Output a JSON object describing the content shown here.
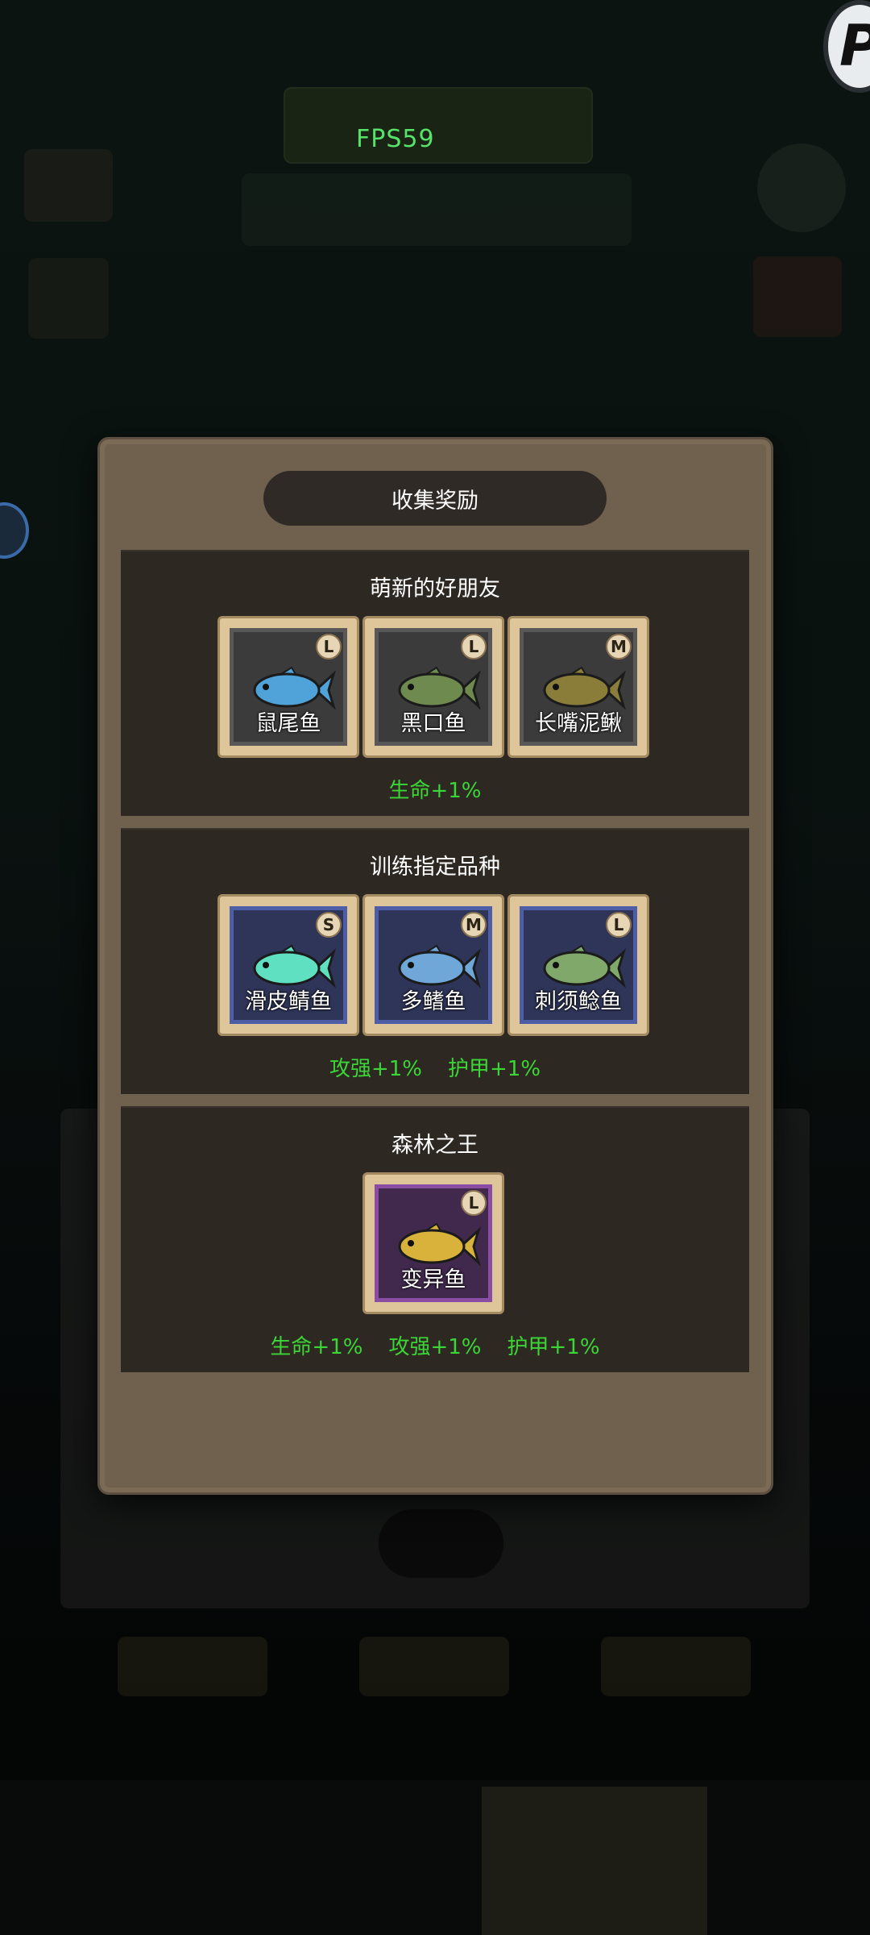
{
  "overlay": {
    "fps": "FPS59"
  },
  "modal": {
    "title": "收集奖励",
    "sections": [
      {
        "title": "萌新的好朋友",
        "fish": [
          {
            "name": "鼠尾鱼",
            "rank": "L",
            "frame": "gray",
            "color": "#4fa3d8"
          },
          {
            "name": "黑口鱼",
            "rank": "L",
            "frame": "gray",
            "color": "#6f8a4e"
          },
          {
            "name": "长嘴泥鳅",
            "rank": "M",
            "frame": "gray",
            "color": "#8a7d3a"
          }
        ],
        "bonuses": [
          "生命+1%"
        ]
      },
      {
        "title": "训练指定品种",
        "fish": [
          {
            "name": "滑皮鲭鱼",
            "rank": "S",
            "frame": "blue",
            "color": "#5fe0c0"
          },
          {
            "name": "多鳍鱼",
            "rank": "M",
            "frame": "blue",
            "color": "#6fa8d8"
          },
          {
            "name": "刺须鲶鱼",
            "rank": "L",
            "frame": "blue",
            "color": "#7fa86a"
          }
        ],
        "bonuses": [
          "攻强+1%",
          "护甲+1%"
        ]
      },
      {
        "title": "森林之王",
        "fish": [
          {
            "name": "变异鱼",
            "rank": "L",
            "frame": "purple",
            "color": "#d8b23a"
          }
        ],
        "bonuses": [
          "生命+1%",
          "攻强+1%",
          "护甲+1%"
        ]
      }
    ]
  },
  "colors": {
    "bonus_text": "#3bd636",
    "modal_bg": "#70604e",
    "section_bg": "#2d2822",
    "card_frame": "#dfc59a"
  }
}
